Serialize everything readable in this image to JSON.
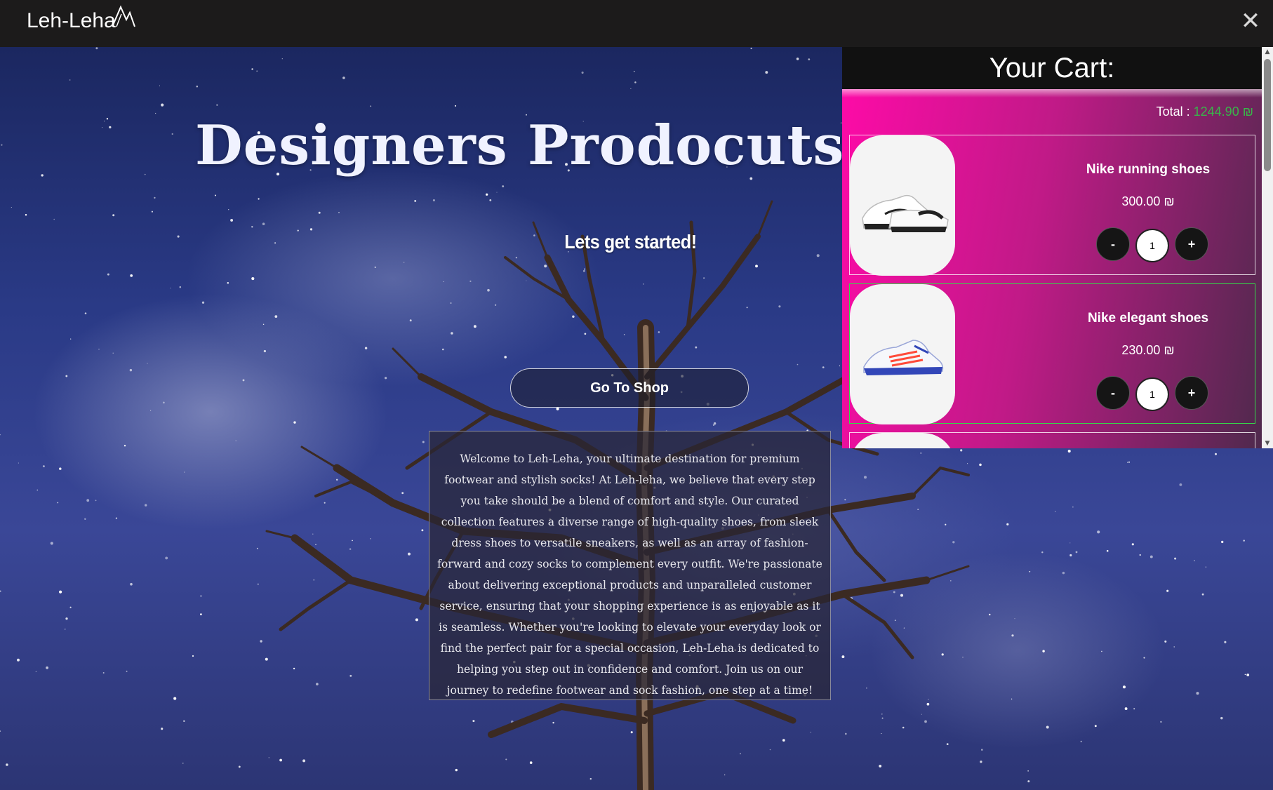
{
  "nav": {
    "logo_text": "Leh-Leha",
    "close_icon": "close-icon"
  },
  "hero": {
    "title": "Designers Prodocuts A",
    "subtitle": "Lets get started!",
    "shop_button": "Go To Shop",
    "about_text": "Welcome to Leh-Leha, your ultimate destination for premium footwear and stylish socks! At Leh-leha, we believe that every step you take should be a blend of comfort and style. Our curated collection features a diverse range of high-quality shoes, from sleek dress shoes to versatile sneakers, as well as an array of fashion-forward and cozy socks to complement every outfit. We're passionate about delivering exceptional products and unparalleled customer service, ensuring that your shopping experience is as enjoyable as it is seamless. Whether you're looking to elevate your everyday look or find the perfect pair for a special occasion, Leh-Leha is dedicated to helping you step out in confidence and comfort. Join us on our journey to redefine footwear and sock fashion, one step at a time!"
  },
  "cart": {
    "title": "Your Cart:",
    "total_label": "Total :",
    "total_value": "1244.90 ₪",
    "items": [
      {
        "name": "Nike running shoes",
        "price": "300.00 ₪",
        "qty": "1",
        "minus": "-",
        "plus": "+"
      },
      {
        "name": "Nike elegant shoes",
        "price": "230.00 ₪",
        "qty": "1",
        "minus": "-",
        "plus": "+"
      }
    ]
  },
  "colors": {
    "cart_gradient_start": "#ff0aa8",
    "cart_gradient_end": "#4a2a4a",
    "total_value": "#39b54a",
    "topbar": "#1c1b1b"
  }
}
